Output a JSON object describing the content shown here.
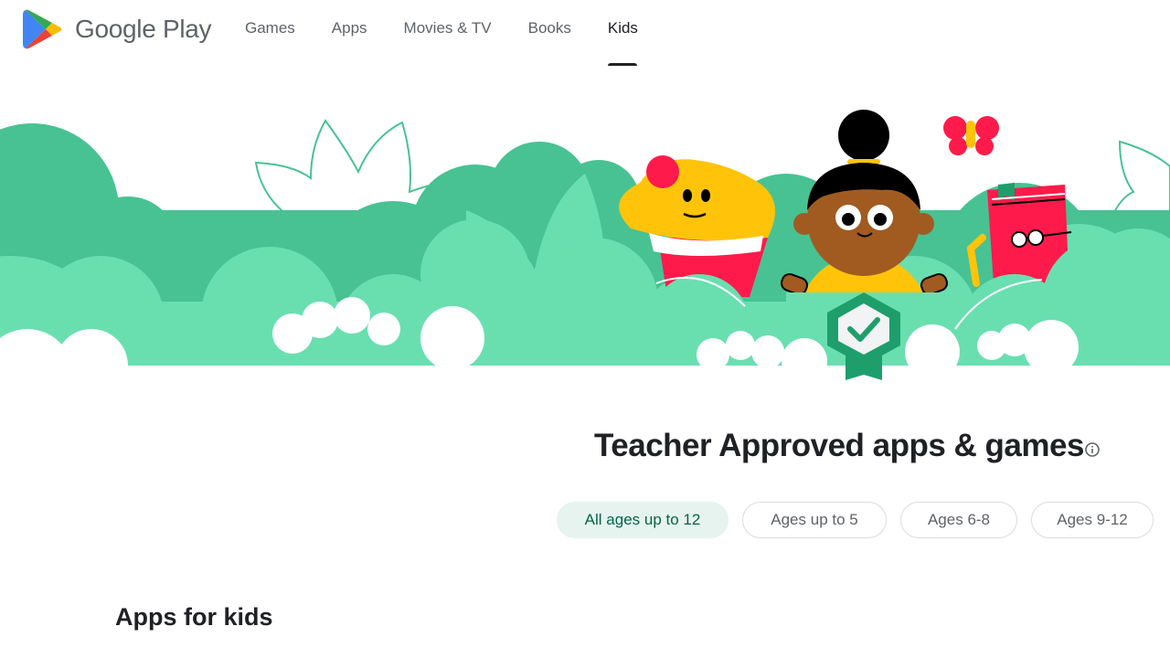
{
  "header": {
    "brand": "Google Play",
    "logo_icon": "google-play-logo-icon",
    "nav": [
      {
        "label": "Games",
        "active": false
      },
      {
        "label": "Apps",
        "active": false
      },
      {
        "label": "Movies & TV",
        "active": false
      },
      {
        "label": "Books",
        "active": false
      },
      {
        "label": "Kids",
        "active": true
      }
    ]
  },
  "hero": {
    "illustration": "kids-teacher-approved-banner",
    "characters": [
      "cupcake",
      "girl-with-bun",
      "butterfly",
      "book-with-glasses",
      "teacher-approved-badge"
    ],
    "colors": {
      "dark_green": "#48c293",
      "light_green": "#69dfb0",
      "red": "#fe1b4b",
      "yellow": "#ffc40a",
      "skin": "#a15b21",
      "badge_green": "#1e9e6b"
    }
  },
  "teacher_approved": {
    "title": "Teacher Approved apps & games",
    "info_icon": "info-icon",
    "filters": [
      {
        "label": "All ages up to 12",
        "selected": true
      },
      {
        "label": "Ages up to 5",
        "selected": false
      },
      {
        "label": "Ages 6-8",
        "selected": false
      },
      {
        "label": "Ages 9-12",
        "selected": false
      }
    ]
  },
  "apps_section": {
    "heading": "Apps for kids"
  }
}
